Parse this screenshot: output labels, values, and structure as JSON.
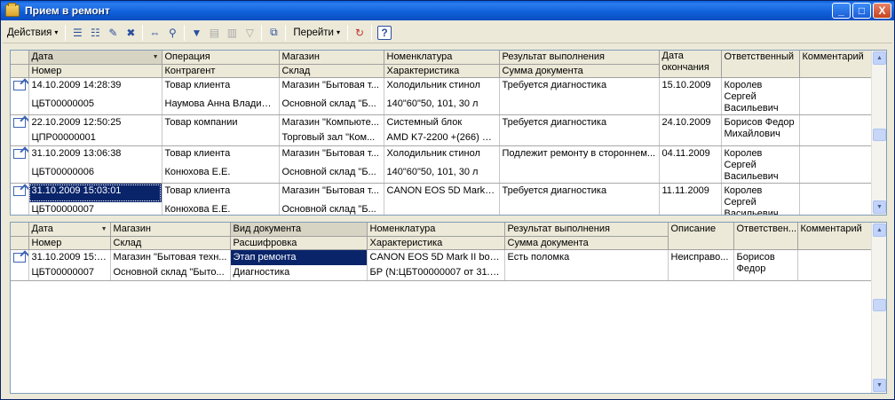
{
  "window": {
    "title": "Прием в ремонт",
    "minimize": "_",
    "maximize": "□",
    "close": "X"
  },
  "toolbar": {
    "actions_label": "Действия",
    "goto_label": "Перейти",
    "help_label": "?",
    "arrow": "▾"
  },
  "top_table": {
    "headers_row1": [
      "Дата",
      "Операция",
      "Магазин",
      "Номенклатура",
      "Результат выполнения",
      "Дата окончания",
      "Ответственный",
      "Комментарий"
    ],
    "headers_row2": [
      "Номер",
      "Контрагент",
      "Склад",
      "Характеристика",
      "Сумма документа"
    ],
    "rows": [
      {
        "date": "14.10.2009 14:28:39",
        "number": "ЦБТ00000005",
        "operation": "Товар клиента",
        "contractor": "Наумова Анна Владим...",
        "shop": "Магазин \"Бытовая т...",
        "warehouse": "Основной склад \"Б...",
        "nomenclature": "Холодильник стинол",
        "characteristic": "140\"60\"50, 101, 30 л",
        "result": "Требуется диагностика",
        "sum": "",
        "end_date": "15.10.2009",
        "responsible": "Королев Сергей Васильевич",
        "comment": ""
      },
      {
        "date": "22.10.2009 12:50:25",
        "number": "ЦПР00000001",
        "operation": "Товар компании",
        "contractor": "",
        "shop": "Магазин \"Компьюте...",
        "warehouse": "Торговый зал \"Ком...",
        "nomenclature": "Системный блок",
        "characteristic": "AMD K7-2200 +(266) G...",
        "result": "Требуется диагностика",
        "sum": "",
        "end_date": "24.10.2009",
        "responsible": "Борисов Федор Михайлович",
        "comment": ""
      },
      {
        "date": "31.10.2009 13:06:38",
        "number": "ЦБТ00000006",
        "operation": "Товар клиента",
        "contractor": "Конюхова Е.Е.",
        "shop": "Магазин \"Бытовая т...",
        "warehouse": "Основной склад \"Б...",
        "nomenclature": "Холодильник стинол",
        "characteristic": "140\"60\"50, 101, 30 л",
        "result": "Подлежит ремонту в стороннем...",
        "sum": "",
        "end_date": "04.11.2009",
        "responsible": "Королев Сергей Васильевич",
        "comment": ""
      },
      {
        "date": "31.10.2009 15:03:01",
        "number": "ЦБТ00000007",
        "operation": "Товар клиента",
        "contractor": "Конюхова Е.Е.",
        "shop": "Магазин \"Бытовая т...",
        "warehouse": "Основной склад \"Б...",
        "nomenclature": "CANON EOS 5D Mark II...",
        "characteristic": "",
        "result": "Требуется диагностика",
        "sum": "",
        "end_date": "11.11.2009",
        "responsible": "Королев Сергей Васильевич",
        "comment": ""
      }
    ]
  },
  "bottom_table": {
    "headers_row1": [
      "Дата",
      "Магазин",
      "Вид документа",
      "Номенклатура",
      "Результат выполнения",
      "Описание",
      "Ответствен...",
      "Комментарий"
    ],
    "headers_row2": [
      "Номер",
      "Склад",
      "Расшифровка",
      "Характеристика",
      "Сумма документа"
    ],
    "rows": [
      {
        "date": "31.10.2009 15:0...",
        "number": "ЦБТ00000007",
        "shop": "Магазин \"Бытовая техн...",
        "warehouse": "Основной склад \"Быто...",
        "doc_type": "Этап ремонта",
        "decoding": "Диагностика",
        "nomenclature": "CANON EOS 5D Mark II body...",
        "characteristic": "БР (N:ЦБТ00000007 от 31.1...",
        "result": "Есть поломка",
        "sum": "",
        "description": "Неисправо...",
        "responsible": "Борисов Федор",
        "comment": ""
      }
    ]
  }
}
